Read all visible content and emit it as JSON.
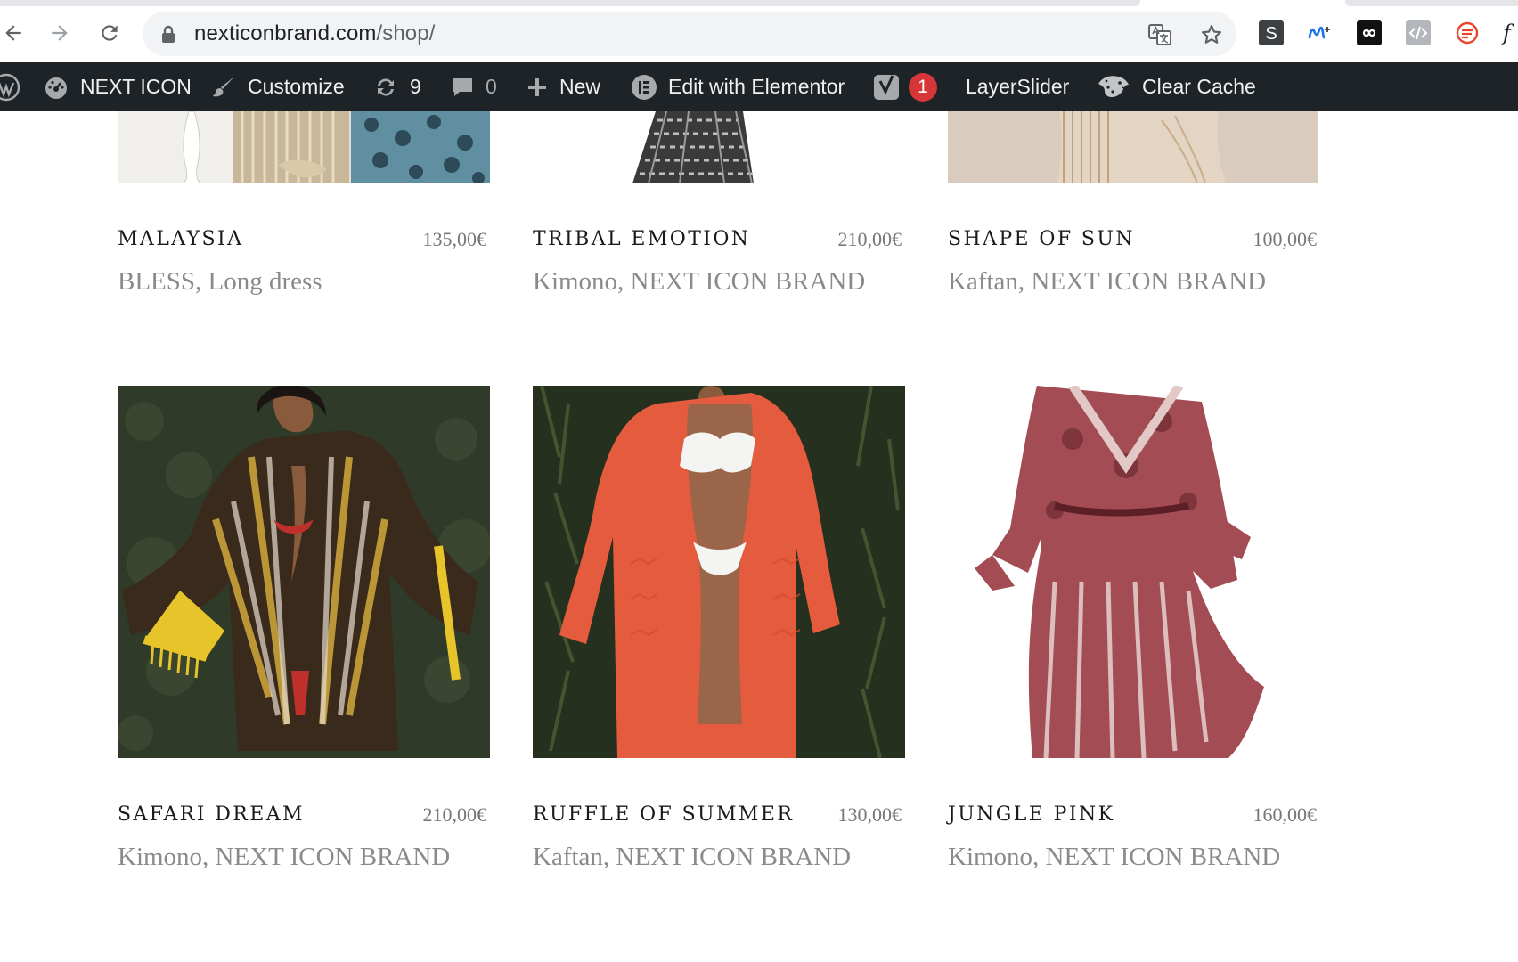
{
  "browser": {
    "url_domain": "nexticonbrand.com",
    "url_path": "/shop/"
  },
  "adminbar": {
    "site_name": "NEXT ICON",
    "customize": "Customize",
    "updates_count": "9",
    "comments_count": "0",
    "new_label": "New",
    "elementor": "Edit with Elementor",
    "yoast_badge": "1",
    "layerslider": "LayerSlider",
    "clear_cache": "Clear Cache"
  },
  "products": [
    {
      "title": "MALAYSIA",
      "price": "135,00€",
      "cats": "BLESS, Long dress"
    },
    {
      "title": "TRIBAL EMOTION",
      "price": "210,00€",
      "cats": "Kimono, NEXT ICON BRAND"
    },
    {
      "title": "SHAPE OF SUN",
      "price": "100,00€",
      "cats": "Kaftan, NEXT ICON BRAND"
    },
    {
      "title": "SAFARI DREAM",
      "price": "210,00€",
      "cats": "Kimono, NEXT ICON BRAND"
    },
    {
      "title": "RUFFLE OF SUMMER",
      "price": "130,00€",
      "cats": "Kaftan, NEXT ICON BRAND"
    },
    {
      "title": "JUNGLE PINK",
      "price": "160,00€",
      "cats": "Kimono, NEXT ICON BRAND"
    }
  ],
  "colors": {
    "adminbar_bg": "#1d2327",
    "badge": "#d63638",
    "title": "#1a1a1a",
    "price": "#777777",
    "category": "#8a8a8a"
  }
}
